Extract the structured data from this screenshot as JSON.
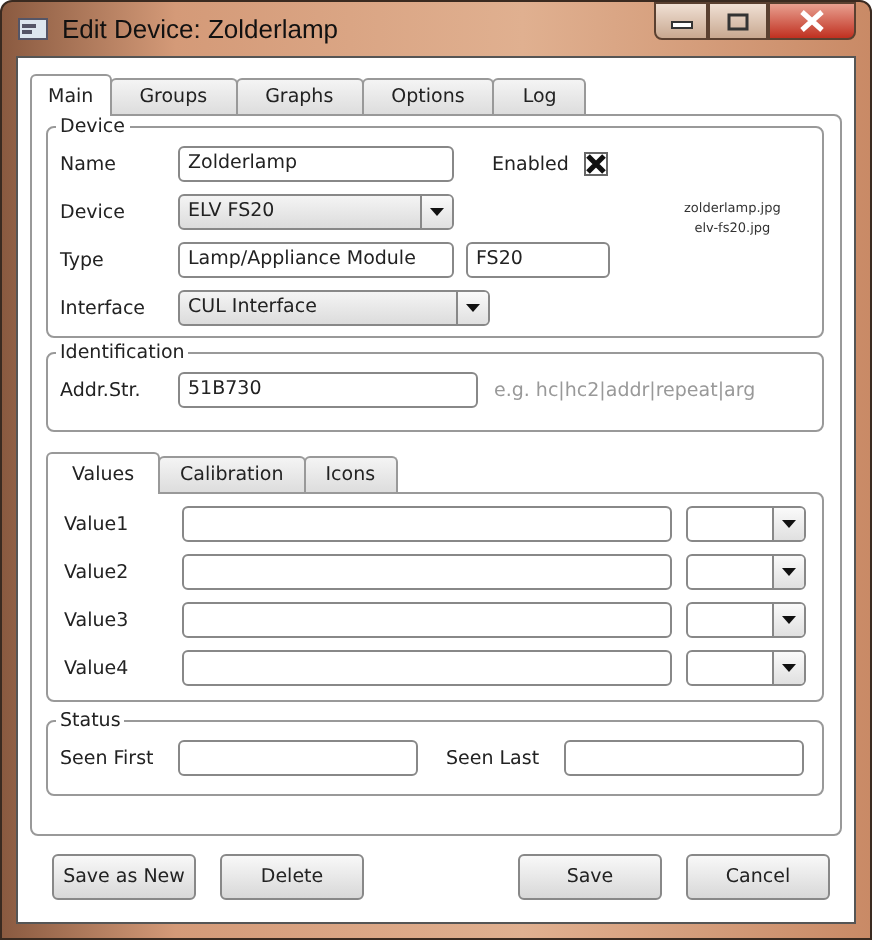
{
  "window": {
    "title": "Edit Device: Zolderlamp"
  },
  "tabs": [
    {
      "label": "Main",
      "selected": true
    },
    {
      "label": "Groups",
      "selected": false
    },
    {
      "label": "Graphs",
      "selected": false
    },
    {
      "label": "Options",
      "selected": false
    },
    {
      "label": "Log",
      "selected": false
    }
  ],
  "device": {
    "legend": "Device",
    "name_label": "Name",
    "name": "Zolderlamp",
    "enabled_label": "Enabled",
    "enabled": true,
    "device_label": "Device",
    "device": "ELV FS20",
    "type_label": "Type",
    "type": "Lamp/Appliance Module",
    "type_code": "FS20",
    "interface_label": "Interface",
    "interface": "CUL Interface",
    "images": [
      "zolderlamp.jpg",
      "elv-fs20.jpg"
    ]
  },
  "identification": {
    "legend": "Identification",
    "addr_label": "Addr.Str.",
    "addr": "51B730",
    "hint": "e.g. hc|hc2|addr|repeat|arg"
  },
  "value_tabs": [
    {
      "label": "Values",
      "selected": true
    },
    {
      "label": "Calibration",
      "selected": false
    },
    {
      "label": "Icons",
      "selected": false
    }
  ],
  "values": [
    {
      "label": "Value1"
    },
    {
      "label": "Value2"
    },
    {
      "label": "Value3"
    },
    {
      "label": "Value4"
    }
  ],
  "status": {
    "legend": "Status",
    "seen_first_label": "Seen First",
    "seen_last_label": "Seen Last"
  },
  "buttons": [
    "Save as New",
    "Delete",
    "Save",
    "Cancel"
  ]
}
